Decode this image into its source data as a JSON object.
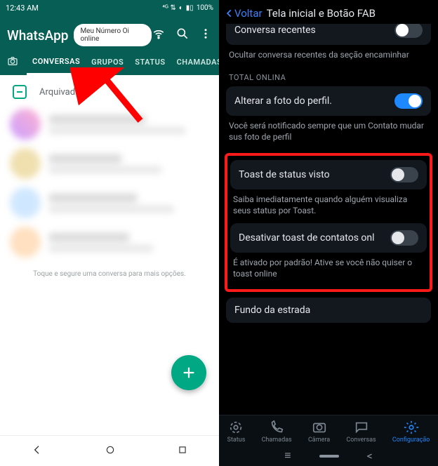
{
  "left": {
    "statusbar": {
      "time": "12:43 AM",
      "battery": "100%"
    },
    "app_title": "WhatsApp",
    "pill": "Meu Número Oi online",
    "tabs": {
      "conversas": "CONVERSAS",
      "grupos": "GRUPOS",
      "status": "STATUS",
      "chamadas": "CHAMADAS"
    },
    "archived": "Arquivadas",
    "hint": "Toque e segure uma conversa para mais opções.",
    "fab_plus": "+"
  },
  "right": {
    "back": "Voltar",
    "title": "Tela inicial e Botão FAB",
    "row_truncated": "Conversa recentes",
    "sub_truncated": "Ocultar conversa recentes da seção encaminhar",
    "section_total": "TOTAL ONLINA",
    "row_profile": "Alterar a foto do perfil.",
    "sub_profile": "Você será notificado sempre que um Contato mudar sus foto de perfil",
    "row_toast_status": "Toast de status visto",
    "sub_toast_status": "Saiba imediatamente quando alguém visualiza seus status por Toast.",
    "row_toast_online": "Desativar toast de contatos onl",
    "sub_toast_online": "É ativado por padrão! Ative se você não quiser o toast online",
    "row_road": "Fundo da estrada",
    "nav": {
      "status": "Status",
      "chamadas": "Chamadas",
      "camera": "Câmera",
      "conversas": "Conversas",
      "config": "Configuração"
    }
  }
}
